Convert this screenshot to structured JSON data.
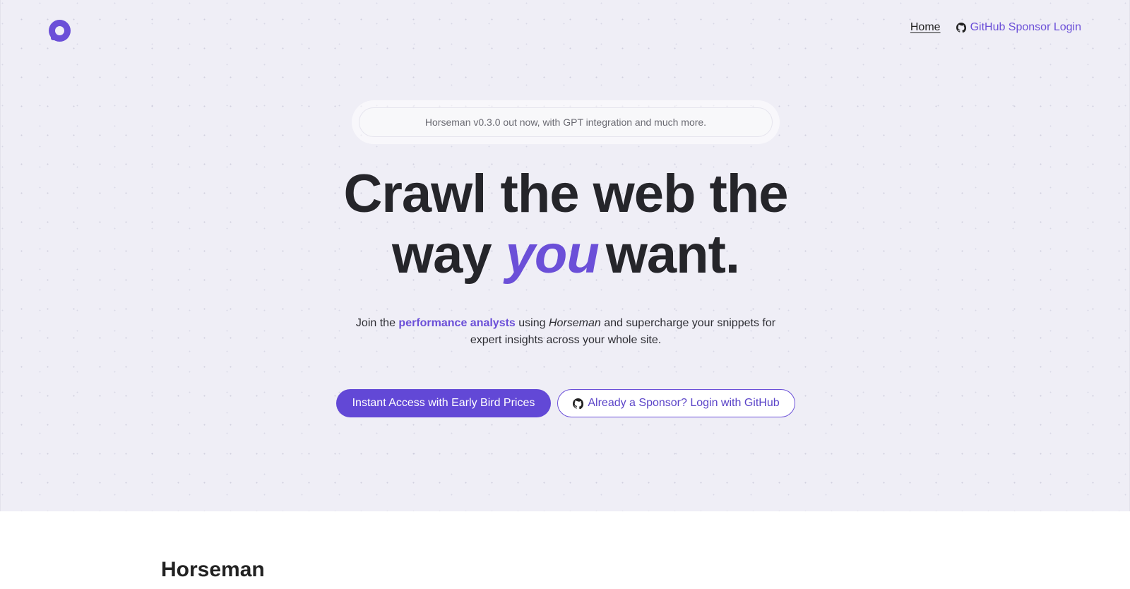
{
  "nav": {
    "logo": "logo-icon",
    "home_label": "Home",
    "github_login_label": "GitHub Sponsor Login"
  },
  "announcement": {
    "text": "Horseman v0.3.0 out now, with GPT integration and much more."
  },
  "hero": {
    "headline_line1": "Crawl the web the",
    "headline_way": "way",
    "headline_you": "you",
    "headline_want": "want.",
    "sub_prefix": "Join the",
    "sub_highlight": "performance analysts",
    "sub_using": "using",
    "sub_product": "Horseman",
    "sub_suffix": "and supercharge your snippets for expert insights across your whole site."
  },
  "cta": {
    "primary_label": "Instant Access with Early Bird Prices",
    "secondary_label": "Already a Sponsor? Login with GitHub"
  },
  "section": {
    "title": "Horseman"
  },
  "colors": {
    "accent": "#6b4fd8",
    "hero_bg": "#efeef6",
    "text": "#25252a"
  }
}
